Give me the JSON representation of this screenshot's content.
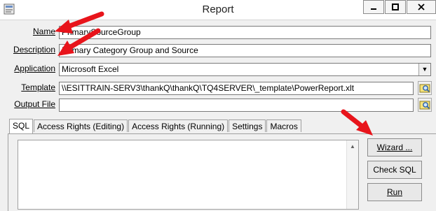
{
  "window": {
    "title": "Report",
    "minimize_glyph": "▬",
    "maximize_glyph": "□",
    "close_glyph": "✕"
  },
  "form": {
    "name_label": "Name",
    "name_value": "PrimarySourceGroup",
    "description_label": "Description",
    "description_value": "Primary Category Group and Source",
    "application_label": "Application",
    "application_value": "Microsoft Excel",
    "template_label": "Template",
    "template_value": "\\\\ESITTRAIN-SERV3\\thankQ\\thankQ\\TQ4SERVER\\_template\\PowerReport.xlt",
    "output_label": "Output File",
    "output_value": ""
  },
  "tabs": [
    {
      "label": "SQL",
      "active": true
    },
    {
      "label": "Access Rights (Editing)",
      "active": false
    },
    {
      "label": "Access Rights (Running)",
      "active": false
    },
    {
      "label": "Settings",
      "active": false
    },
    {
      "label": "Macros",
      "active": false
    }
  ],
  "buttons": {
    "wizard": "Wizard ...",
    "check_sql": "Check SQL",
    "run": "Run"
  },
  "colors": {
    "annotation_arrow": "#e8141b"
  }
}
